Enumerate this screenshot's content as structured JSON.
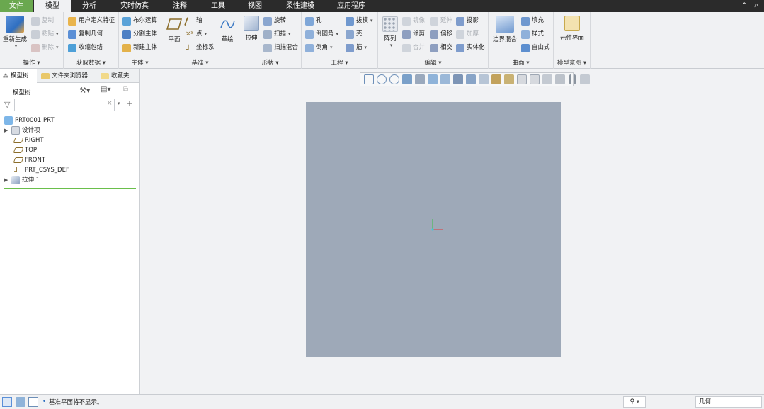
{
  "menu": {
    "tabs": [
      "文件",
      "模型",
      "分析",
      "实时仿真",
      "注释",
      "工具",
      "视图",
      "柔性建模",
      "应用程序"
    ]
  },
  "ribbon": {
    "operations": {
      "label": "操作",
      "regen": "重新生成",
      "copy": "复制",
      "paste": "粘贴",
      "delete": "删除"
    },
    "get_data": {
      "label": "获取数据",
      "udf": "用户定义特征",
      "copy_geom": "复制几何",
      "shrinkwrap": "收缩包络"
    },
    "body": {
      "label": "主体",
      "boolean": "布尔运算",
      "split_body": "分割主体",
      "new_body": "新建主体"
    },
    "datum": {
      "label": "基准",
      "plane": "平面",
      "axis": "轴",
      "point": "点",
      "csys": "坐标系",
      "sketch": "草绘"
    },
    "shapes": {
      "label": "形状",
      "extrude": "拉伸",
      "revolve": "旋转",
      "sweep": "扫描",
      "swept_blend": "扫描混合"
    },
    "engineering": {
      "label": "工程",
      "hole": "孔",
      "round": "倒圆角",
      "chamfer": "倒角",
      "draft": "拔模",
      "shell": "壳",
      "rib": "筋"
    },
    "editing": {
      "label": "编辑",
      "pattern": "阵列",
      "mirror": "镜像",
      "extend": "延伸",
      "project": "投影",
      "trim": "修剪",
      "offset": "偏移",
      "thicken": "加厚",
      "merge": "合并",
      "intersect": "相交",
      "solidify": "实体化"
    },
    "surfaces": {
      "label": "曲面",
      "boundary_blend": "边界混合",
      "fill": "填充",
      "style": "样式",
      "freestyle": "自由式"
    },
    "model_intent": {
      "label": "模型意图",
      "component_interface": "元件界面"
    }
  },
  "left_panel": {
    "tabs": [
      "模型树",
      "文件夹浏览器",
      "收藏夹"
    ],
    "tree_header": "模型树",
    "search_placeholder": "",
    "tree": [
      "PRT0001.PRT",
      "设计项",
      "RIGHT",
      "TOP",
      "FRONT",
      "PRT_CSYS_DEF",
      "拉伸 1"
    ]
  },
  "status": {
    "message": "基准平面将不显示。",
    "filter_value": "几何"
  },
  "colors": {
    "menubar": "#2b2b2b",
    "file_tab": "#6aa84f",
    "canvas": "#9ea9b8",
    "insert_line": "#6abf4b"
  },
  "view_toolbar_icons": [
    "refit-icon",
    "zoom-in-icon",
    "zoom-out-icon",
    "repaint-icon",
    "spin-center-icon",
    "view-orient-icon",
    "saved-views-icon",
    "display-style-icon",
    "datum-display-icon",
    "annotation-display-icon",
    "section-icon",
    "csys-display-icon",
    "point-display-icon",
    "plane-display-icon",
    "axis-display-icon",
    "spin-center-display-icon",
    "pause-icon",
    "animation-icon"
  ]
}
